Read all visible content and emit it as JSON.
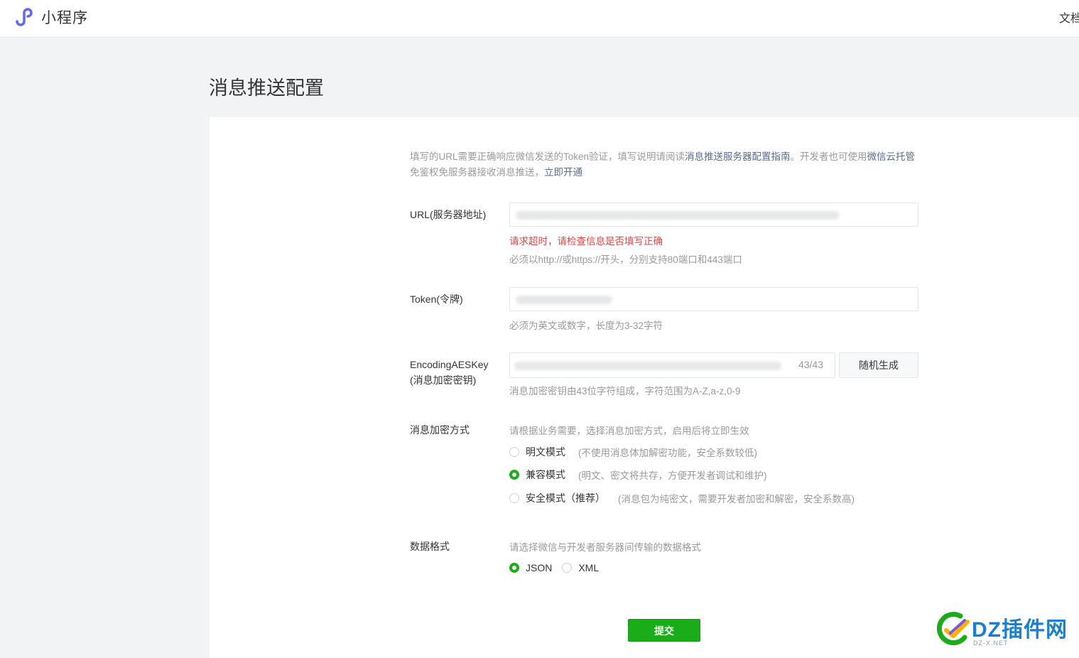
{
  "header": {
    "app_name": "小程序",
    "doc_link": "文档"
  },
  "page": {
    "title": "消息推送配置"
  },
  "intro": {
    "text1": "填写的URL需要正确响应微信发送的Token验证，填写说明请阅读",
    "link1": "消息推送服务器配置指南",
    "text2": "。开发者也可使用",
    "link2": "微信云托管",
    "text3": "免鉴权免服务器接收消息推送，",
    "link3": "立即开通"
  },
  "form": {
    "url": {
      "label": "URL(服务器地址)",
      "error": "请求超时，请检查信息是否填写正确",
      "hint": "必须以http://或https://开头，分别支持80端口和443端口"
    },
    "token": {
      "label": "Token(令牌)",
      "hint": "必须为英文或数字，长度为3-32字符"
    },
    "aes": {
      "label_line1": "EncodingAESKey",
      "label_line2": "(消息加密密钥)",
      "counter": "43/43",
      "generate_button": "随机生成",
      "hint": "消息加密密钥由43位字符组成，字符范围为A-Z,a-z,0-9"
    },
    "encryption": {
      "label": "消息加密方式",
      "hint": "请根据业务需要，选择消息加密方式，启用后将立即生效",
      "options": [
        {
          "label": "明文模式",
          "desc": "(不使用消息体加解密功能，安全系数较低)",
          "checked": false
        },
        {
          "label": "兼容模式",
          "desc": "(明文、密文将共存，方便开发者调试和维护)",
          "checked": true
        },
        {
          "label": "安全模式（推荐）",
          "desc": "(消息包为纯密文，需要开发者加密和解密，安全系数高)",
          "checked": false
        }
      ]
    },
    "data_format": {
      "label": "数据格式",
      "hint": "请选择微信与开发者服务器间传输的数据格式",
      "options": [
        {
          "label": "JSON",
          "checked": true
        },
        {
          "label": "XML",
          "checked": false
        }
      ]
    },
    "submit_label": "提交"
  },
  "watermark": {
    "text": "DZ插件网",
    "sub": "DZ-X.NET"
  },
  "colors": {
    "accent_green": "#1aad19",
    "link_blue": "#576b95",
    "error_red": "#e64340",
    "logo_purple": "#6467f0"
  },
  "icons": {
    "logo": "mini-program-logo-icon",
    "watermark": "dz-logo-icon"
  }
}
